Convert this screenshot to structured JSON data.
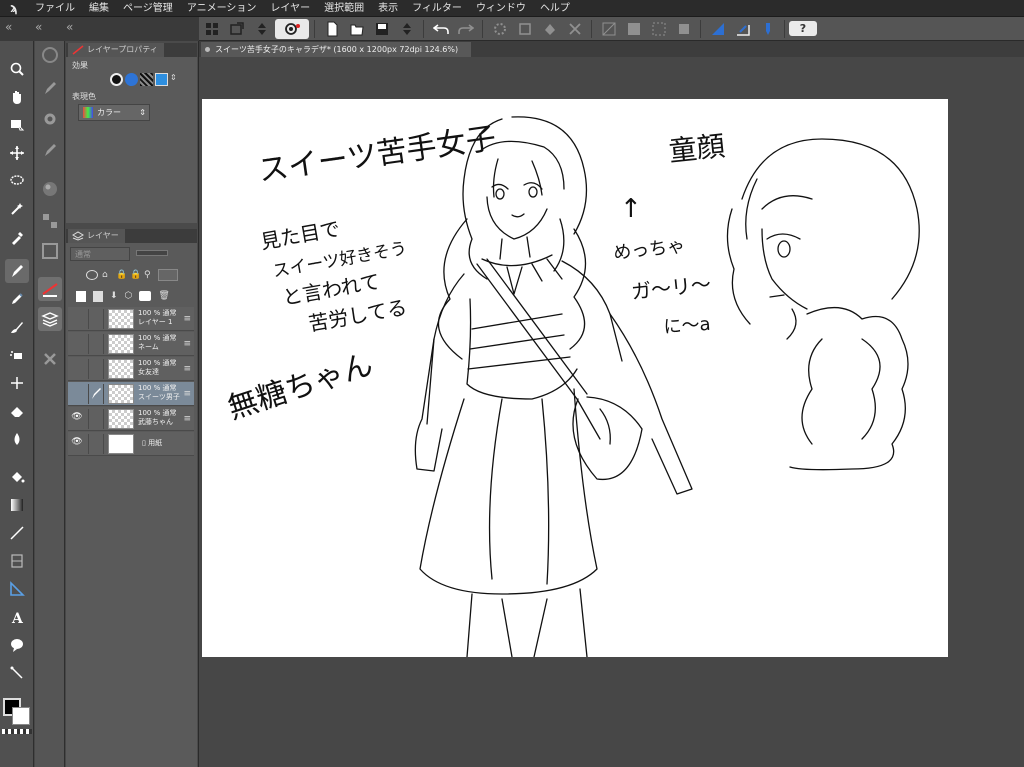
{
  "menu": {
    "items": [
      "ファイル",
      "編集",
      "ページ管理",
      "アニメーション",
      "レイヤー",
      "選択範囲",
      "表示",
      "フィルター",
      "ウィンドウ",
      "ヘルプ"
    ]
  },
  "panels": {
    "layer_property": {
      "tab_label": "レイヤープロパティ",
      "effect_label": "効果",
      "expression_color_label": "表現色",
      "expression_color_value": "カラー"
    },
    "layers": {
      "tab_label": "レイヤー",
      "blend_mode": "通常",
      "items": [
        {
          "opacity": "100 %",
          "mode": "通常",
          "name": "レイヤー 1",
          "visible": false,
          "selected": false,
          "paper": false
        },
        {
          "opacity": "100 %",
          "mode": "通常",
          "name": "ネーム",
          "visible": false,
          "selected": false,
          "paper": false
        },
        {
          "opacity": "100 %",
          "mode": "通常",
          "name": "女友達",
          "visible": false,
          "selected": false,
          "paper": false
        },
        {
          "opacity": "100 %",
          "mode": "通常",
          "name": "スイーツ男子",
          "visible": false,
          "selected": true,
          "paper": false
        },
        {
          "opacity": "100 %",
          "mode": "通常",
          "name": "武藤ちゃん",
          "visible": true,
          "selected": false,
          "paper": false
        },
        {
          "opacity": "",
          "mode": "",
          "name": "用紙",
          "visible": true,
          "selected": false,
          "paper": true
        }
      ]
    }
  },
  "document": {
    "tab_title": "スイーツ苦手女子のキャラデザ* (1600 x 1200px 72dpi 124.6%)"
  },
  "canvas_text": {
    "title": "スイーツ苦手女子",
    "note1_line1": "見た目で",
    "note1_line2": "スイーツ好きそう",
    "note1_line3": "と言われて",
    "note1_line4": "苦労してる",
    "name_note": "無糖ちゃん",
    "arrow": "↑",
    "note2_line1": "めっちゃ",
    "note2_line2": "ガ～リ～",
    "note2_line3": "に～a",
    "face_label": "童顔"
  },
  "colors": {
    "main_color": "#000000",
    "sub_color": "#ffffff"
  }
}
